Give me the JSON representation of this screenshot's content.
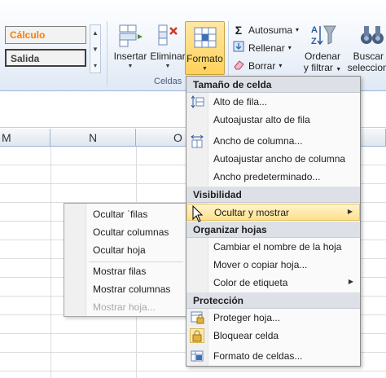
{
  "ribbon": {
    "styles": {
      "calc": "Cálculo",
      "output": "Salida"
    },
    "buttons": {
      "insertar": "Insertar",
      "eliminar": "Eliminar",
      "formato": "Formato",
      "ordenar_line1": "Ordenar",
      "ordenar_line2": "y filtrar",
      "buscar_line1": "Buscar y",
      "buscar_line2": "seleccionar"
    },
    "small": {
      "autosuma": "Autosuma",
      "rellenar": "Rellenar",
      "borrar": "Borrar"
    },
    "group_celdas": "Celdas"
  },
  "grid": {
    "columns": [
      "M",
      "N",
      "O"
    ]
  },
  "menu": {
    "sections": {
      "cell_size": "Tamaño de celda",
      "visibility": "Visibilidad",
      "organize": "Organizar hojas",
      "protection": "Protección"
    },
    "items": {
      "row_height": "Alto de fila...",
      "autofit_row": "Autoajustar alto de fila",
      "col_width": "Ancho de columna...",
      "autofit_col": "Autoajustar ancho de columna",
      "default_width": "Ancho predeterminado...",
      "hide_show": "Ocultar y mostrar",
      "rename": "Cambiar el nombre de la hoja",
      "move_copy": "Mover o copiar hoja...",
      "tab_color": "Color de etiqueta",
      "protect": "Proteger hoja...",
      "lock": "Bloquear celda",
      "format_cells": "Formato de celdas..."
    }
  },
  "submenu": {
    "items": [
      "Ocultar ˈfilas",
      "Ocultar columnas",
      "Ocultar hoja",
      "Mostrar filas",
      "Mostrar columnas",
      "Mostrar hoja..."
    ]
  },
  "colors": {
    "highlight": "#ffe08a",
    "header_bg": "#dde1e7",
    "accent": "#fa7d00"
  }
}
